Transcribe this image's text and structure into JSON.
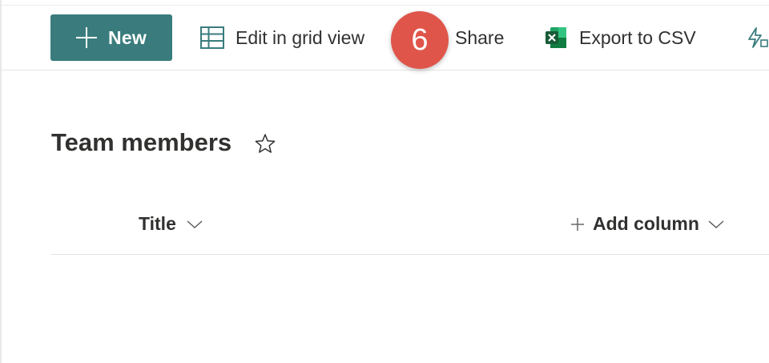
{
  "commandbar": {
    "new_label": "New",
    "edit_grid_label": "Edit in grid view",
    "share_label": "Share",
    "export_label": "Export to CSV",
    "step_badge": "6"
  },
  "list": {
    "title": "Team members",
    "columns": [
      {
        "label": "Title"
      },
      {
        "label": "Add column"
      }
    ]
  },
  "colors": {
    "primary": "#3a7c7d",
    "badge": "#e0554a",
    "excel_green": "#1e7145"
  }
}
